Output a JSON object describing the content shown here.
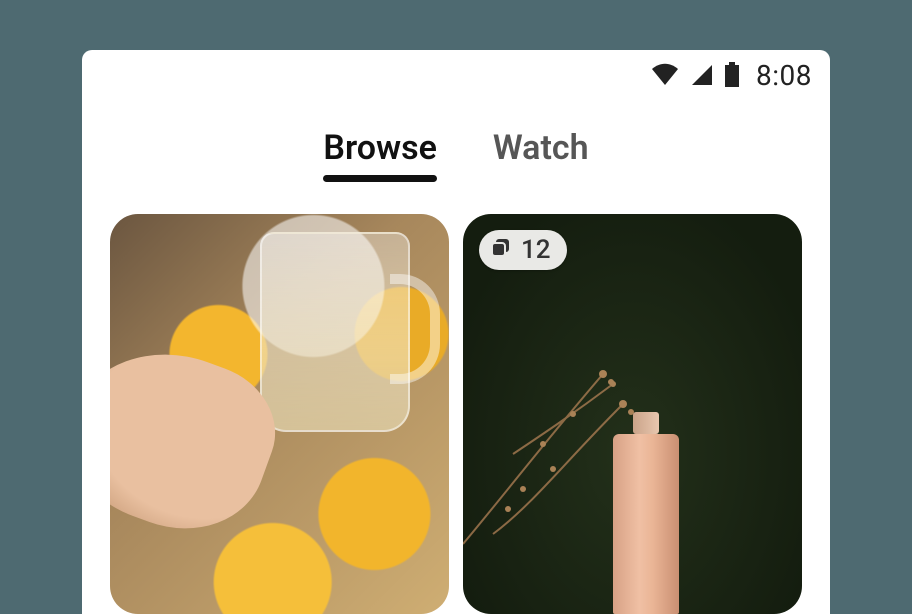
{
  "status": {
    "time": "8:08"
  },
  "tabs": {
    "browse": "Browse",
    "watch": "Watch",
    "active": "browse"
  },
  "cards": {
    "right": {
      "badge_count": "12"
    }
  }
}
